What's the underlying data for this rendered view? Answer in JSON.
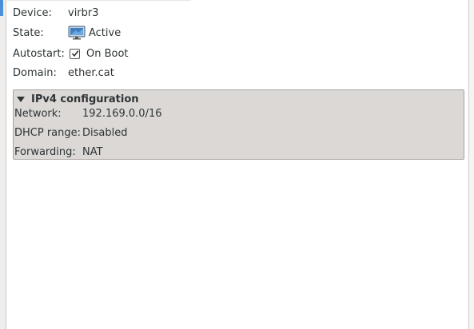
{
  "details": {
    "device_label": "Device:",
    "device_value": "virbr3",
    "state_label": "State:",
    "state_value": "Active",
    "state_icon": "monitor-icon",
    "autostart_label": "Autostart:",
    "autostart_checked": true,
    "autostart_value": "On Boot",
    "domain_label": "Domain:",
    "domain_value": "ether.cat"
  },
  "ipv4": {
    "title": "IPv4 configuration",
    "expanded": true,
    "network_label": "Network:",
    "network_value": "192.169.0.0/16",
    "dhcp_label": "DHCP range:",
    "dhcp_value": "Disabled",
    "forwarding_label": "Forwarding:",
    "forwarding_value": "NAT"
  },
  "colors": {
    "expander_bg": "#dbd8d5",
    "accent": "#4a90d9",
    "text": "#2e3436"
  }
}
